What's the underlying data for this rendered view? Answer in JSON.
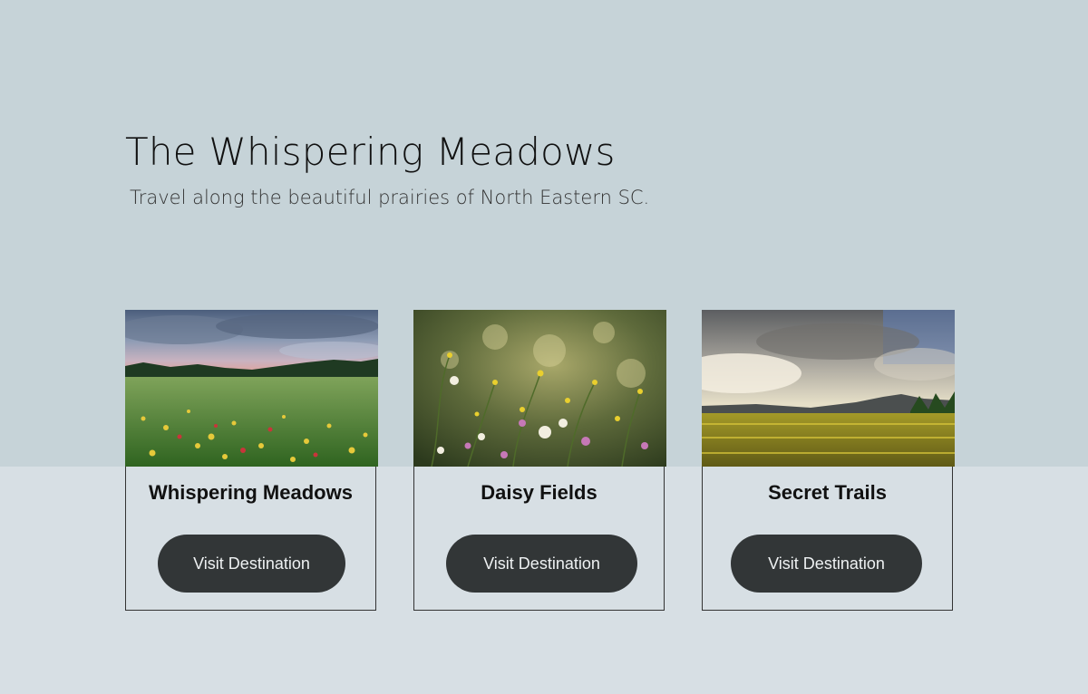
{
  "hero": {
    "title": "The Whispering Meadows",
    "subtitle": "Travel along the beautiful prairies of North Eastern SC."
  },
  "cards": [
    {
      "title": "Whispering Meadows",
      "button_label": "Visit Destination",
      "image_alt": "wildflower meadow under cloudy sky"
    },
    {
      "title": "Daisy Fields",
      "button_label": "Visit Destination",
      "image_alt": "close-up of daisies and wildflowers"
    },
    {
      "title": "Secret Trails",
      "button_label": "Visit Destination",
      "image_alt": "yellow field under dramatic sky"
    }
  ],
  "colors": {
    "top_band": "#c6d3d8",
    "bottom_band": "#d7dfe4",
    "button_bg": "#323637",
    "button_text": "#eef1f2"
  }
}
